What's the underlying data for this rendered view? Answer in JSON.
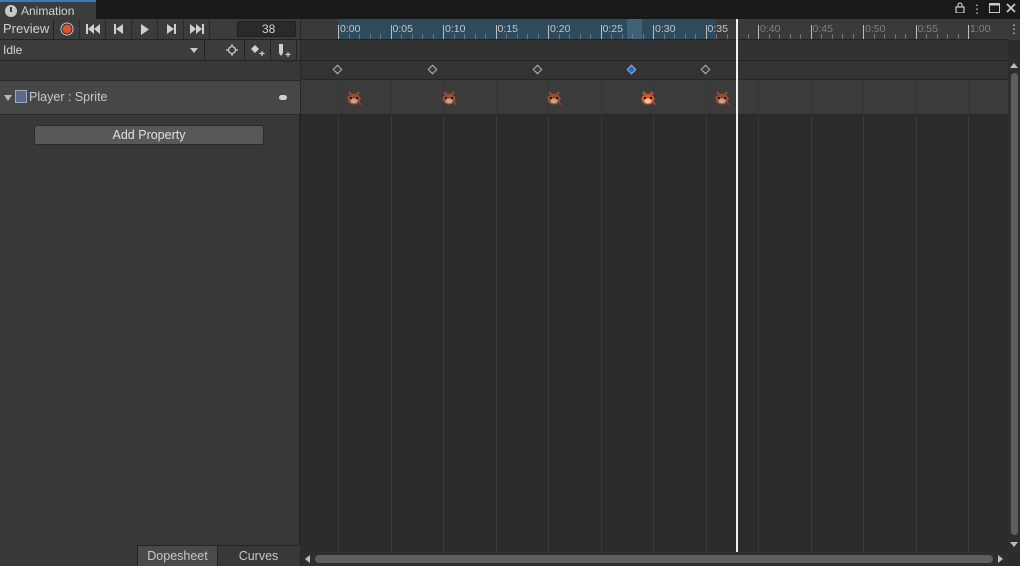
{
  "window": {
    "tab_title": "Animation",
    "lock_icon": "lock-icon",
    "menu_icon": "kebab-menu-icon",
    "maximize_icon": "maximize-icon",
    "close_icon": "close-icon"
  },
  "toolbar": {
    "preview_label": "Preview",
    "record_color": "#e0552b",
    "frame_value": "38",
    "buttons": [
      "record-icon",
      "first-key-icon",
      "prev-key-icon",
      "play-icon",
      "next-key-icon",
      "last-key-icon"
    ]
  },
  "clip": {
    "selected": "Idle",
    "filter_icon": "filter-by-selection-icon",
    "add_keyframe_icon": "add-keyframe-icon",
    "add_event_icon": "add-event-icon"
  },
  "properties": {
    "rows": [
      {
        "label": "Player : Sprite",
        "icon": "sprite-renderer-icon"
      }
    ],
    "add_property_label": "Add Property"
  },
  "bottom_tabs": {
    "dopesheet": "Dopesheet",
    "curves": "Curves",
    "active": "Dopesheet"
  },
  "timeline": {
    "ticks": [
      "0:00",
      "0:05",
      "0:10",
      "0:15",
      "0:20",
      "0:25",
      "0:30",
      "0:35",
      "0:40",
      "0:45",
      "0:50",
      "0:55",
      "1:00"
    ],
    "clip_end_label": "0:35",
    "keyframes": [
      "0:00",
      "0:09",
      "0:19",
      "0:28",
      "0:35"
    ],
    "selected_keyframe": "0:28",
    "playhead_frame": "38",
    "accent_color": "#2f63b8"
  }
}
